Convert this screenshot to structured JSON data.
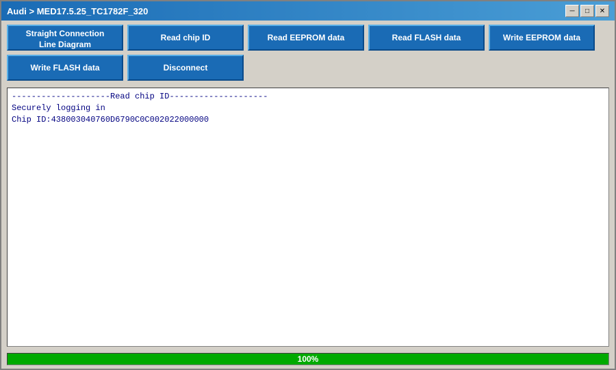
{
  "titlebar": {
    "text": "Audi  >  MED17.5.25_TC1782F_320",
    "separator": ">"
  },
  "buttons": {
    "connection_line": "Straight Connection\nLine Diagram",
    "read_chip_id": "Read chip ID",
    "read_eeprom": "Read EEPROM data",
    "read_flash": "Read FLASH data",
    "write_eeprom": "Write EEPROM data",
    "write_flash": "Write FLASH data",
    "disconnect": "Disconnect"
  },
  "window_controls": {
    "minimize": "─",
    "maximize": "□",
    "close": "✕"
  },
  "log": {
    "line1": "--------------------Read chip ID--------------------",
    "line2": "Securely logging in",
    "line3": "Chip ID:438003040760D6790C0C002022000000"
  },
  "progress": {
    "value": 100,
    "label": "100%"
  }
}
